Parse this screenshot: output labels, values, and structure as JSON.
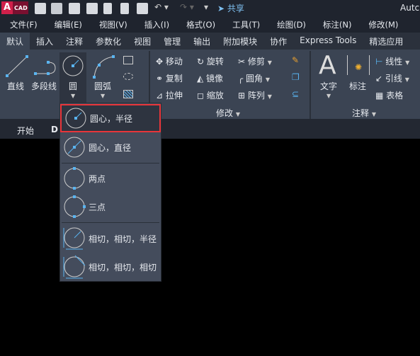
{
  "titlebar": {
    "logo": "A",
    "logo_sub": "CAD",
    "share": "共享",
    "app_title": "Autc"
  },
  "menu": [
    "文件(F)",
    "编辑(E)",
    "视图(V)",
    "插入(I)",
    "格式(O)",
    "工具(T)",
    "绘图(D)",
    "标注(N)",
    "修改(M)"
  ],
  "ribbon_tabs": [
    "默认",
    "插入",
    "注释",
    "参数化",
    "视图",
    "管理",
    "输出",
    "附加模块",
    "协作",
    "Express Tools",
    "精选应用"
  ],
  "draw": {
    "line": "直线",
    "polyline": "多段线",
    "circle": "圆",
    "arc": "圆弧"
  },
  "modify": {
    "move": "移动",
    "rotate": "旋转",
    "trim": "修剪",
    "copy": "复制",
    "mirror": "镜像",
    "fillet": "圆角",
    "stretch": "拉伸",
    "scale": "缩放",
    "array": "阵列",
    "panel": "修改"
  },
  "annotation": {
    "text": "文字",
    "dim": "标注",
    "linear": "线性",
    "leader": "引线",
    "table": "表格",
    "panel": "注释"
  },
  "doc_tabs": {
    "start": "开始",
    "drawing": "D"
  },
  "circle_menu": [
    "圆心，半径",
    "圆心，直径",
    "两点",
    "三点",
    "相切，相切，半径",
    "相切，相切，相切"
  ],
  "colors": {
    "accent": "#5ab4f0",
    "highlight_border": "#e8353a"
  }
}
